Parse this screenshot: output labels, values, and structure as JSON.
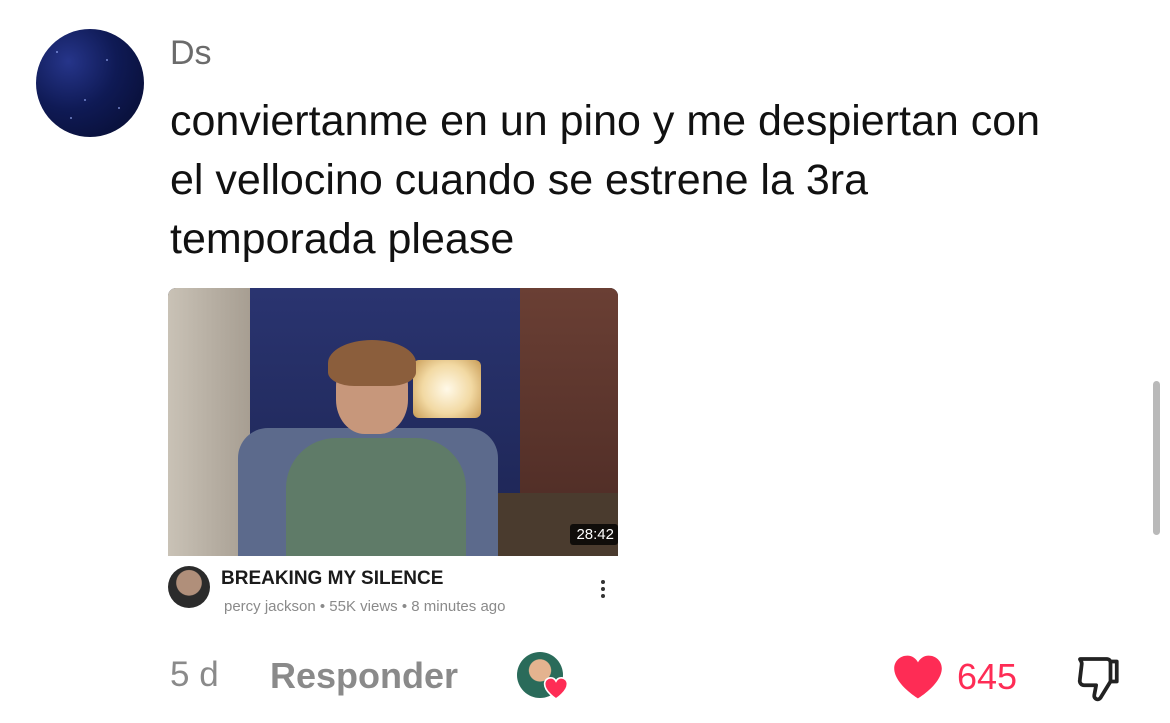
{
  "comment": {
    "username": "Ds",
    "text": "conviertanme en un pino y me despiertan con el vellocino cuando se estrene la 3ra temporada please",
    "time": "5 d",
    "reply_label": "Responder",
    "likes": "645",
    "accent_color": "#fe2c55"
  },
  "video": {
    "duration": "28:42",
    "title": "BREAKING MY SILENCE",
    "subtitle": "percy jackson • 55K views • 8 minutes ago"
  },
  "icons": [
    "avatar",
    "more-vert-icon",
    "heart-icon",
    "thumbs-down-icon"
  ]
}
